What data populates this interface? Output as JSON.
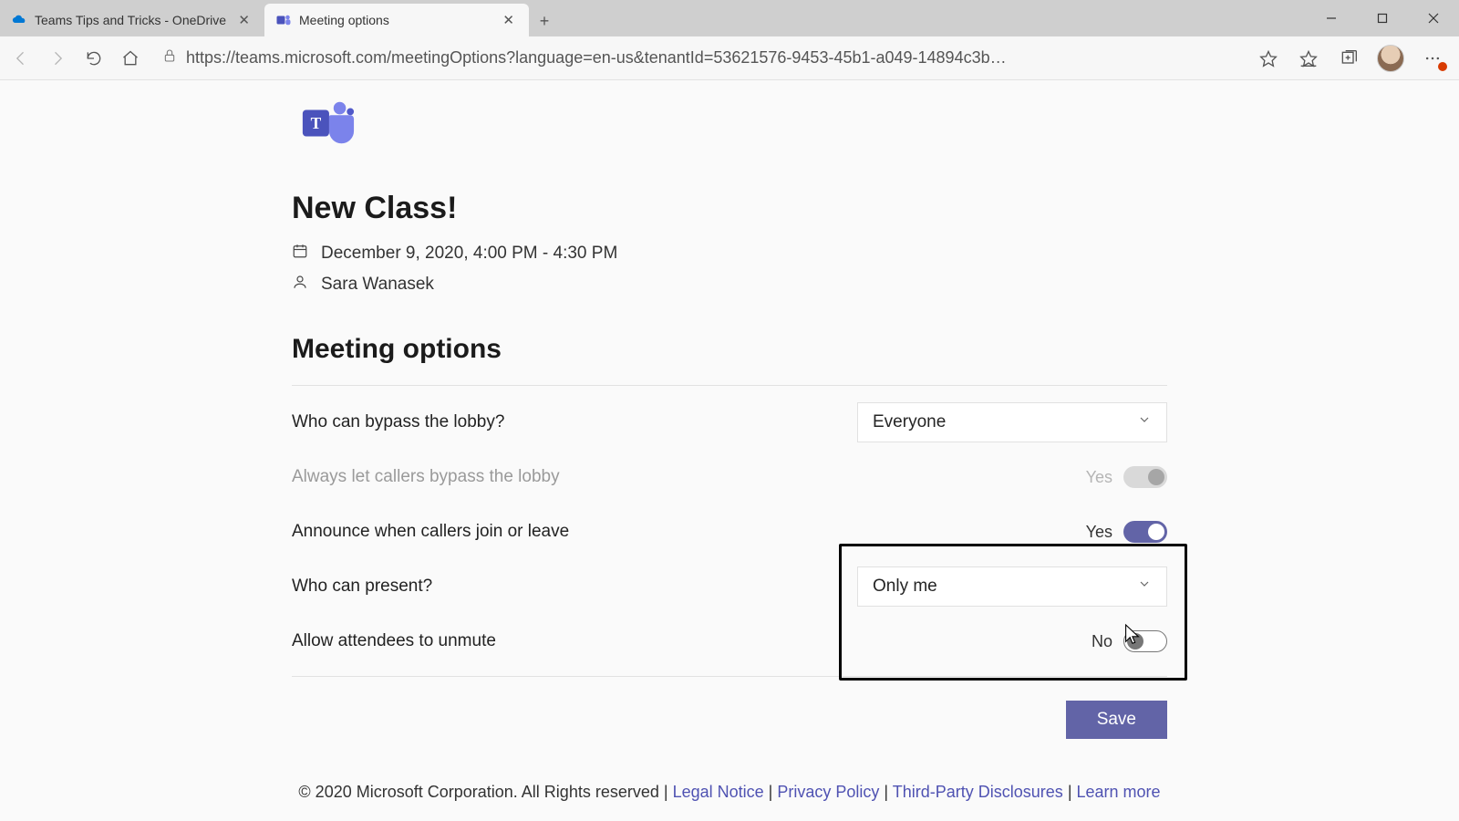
{
  "browser": {
    "tabs": [
      {
        "title": "Teams Tips and Tricks - OneDrive",
        "favicon": "onedrive"
      },
      {
        "title": "Meeting options",
        "favicon": "teams"
      }
    ],
    "url": "https://teams.microsoft.com/meetingOptions?language=en-us&tenantId=53621576-9453-45b1-a049-14894c3b…"
  },
  "meeting": {
    "title": "New Class!",
    "datetime": "December 9, 2020, 4:00 PM - 4:30 PM",
    "organizer": "Sara Wanasek",
    "section_heading": "Meeting options"
  },
  "options": {
    "bypass_lobby": {
      "label": "Who can bypass the lobby?",
      "value": "Everyone"
    },
    "always_bypass": {
      "label": "Always let callers bypass the lobby",
      "value": "Yes"
    },
    "announce": {
      "label": "Announce when callers join or leave",
      "value": "Yes"
    },
    "present": {
      "label": "Who can present?",
      "value": "Only me"
    },
    "unmute": {
      "label": "Allow attendees to unmute",
      "value": "No"
    }
  },
  "actions": {
    "save": "Save"
  },
  "footer": {
    "copyright": "© 2020 Microsoft Corporation. All Rights reserved",
    "sep": "  |  ",
    "links": {
      "legal": "Legal Notice",
      "privacy": "Privacy Policy",
      "third_party": "Third-Party Disclosures",
      "learn": "Learn more"
    }
  }
}
